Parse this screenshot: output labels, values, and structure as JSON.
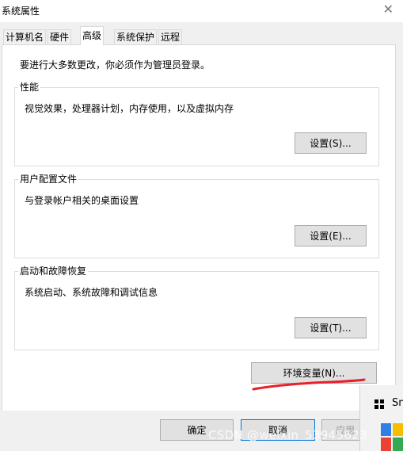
{
  "window": {
    "title": "系统属性",
    "close_glyph": "✕"
  },
  "tabs": [
    {
      "label": "计算机名"
    },
    {
      "label": "硬件"
    },
    {
      "label": "高级"
    },
    {
      "label": "系统保护"
    },
    {
      "label": "远程"
    }
  ],
  "advanced": {
    "notice": "要进行大多数更改，你必须作为管理员登录。",
    "performance": {
      "title": "性能",
      "description": "视觉效果，处理器计划，内存使用，以及虚拟内存",
      "button": "设置(S)..."
    },
    "user_profiles": {
      "title": "用户配置文件",
      "description": "与登录帐户相关的桌面设置",
      "button": "设置(E)..."
    },
    "startup_recovery": {
      "title": "启动和故障恢复",
      "description": "系统启动、系统故障和调试信息",
      "button": "设置(T)..."
    },
    "env_button": "环境变量(N)..."
  },
  "dialog_buttons": {
    "ok": "确定",
    "cancel": "取消",
    "apply": "应用"
  },
  "watermark": "CSDN @weixin_53945623",
  "snip_popup": {
    "label": "Sni"
  },
  "colors": {
    "annotation_red": "#e8202a",
    "focus_blue": "#0078d7"
  }
}
